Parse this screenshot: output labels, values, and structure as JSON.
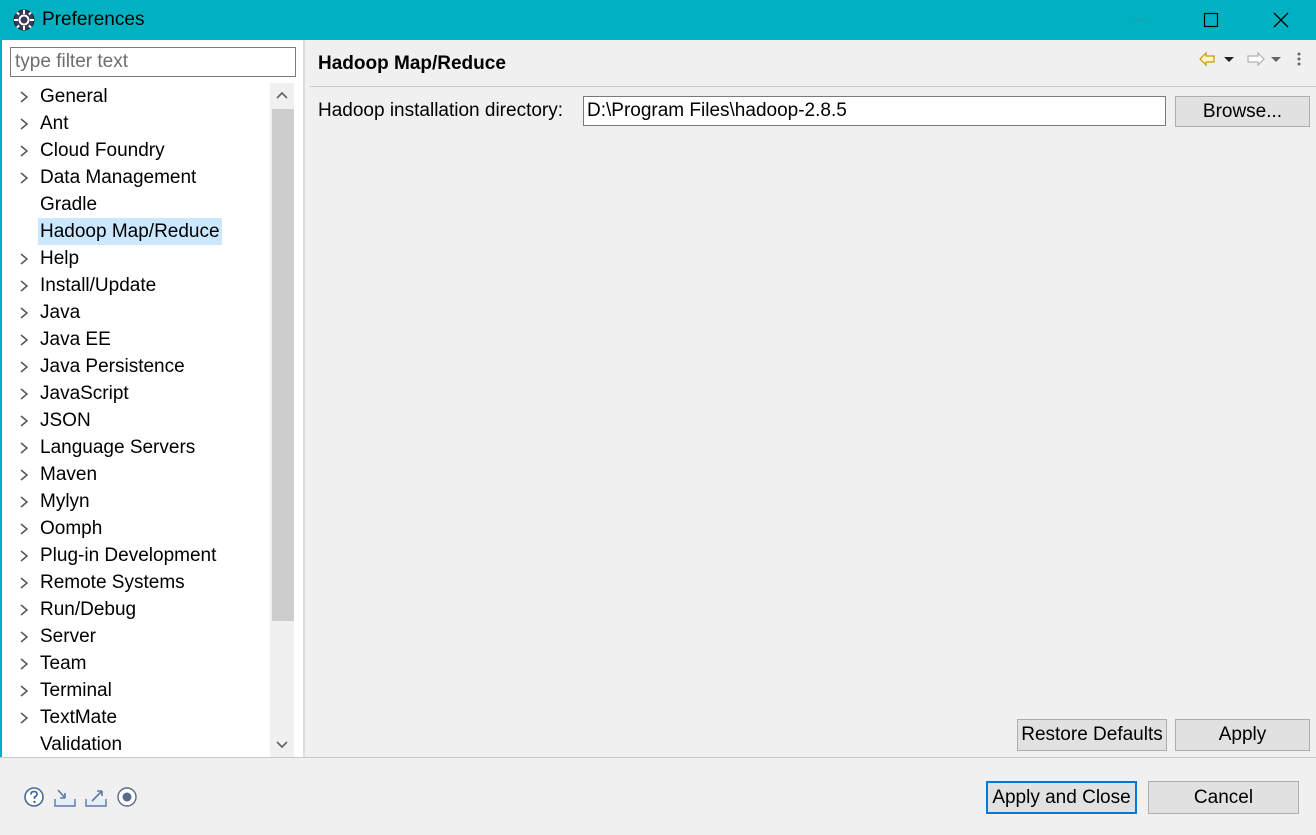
{
  "window": {
    "title": "Preferences"
  },
  "filter": {
    "placeholder": "type filter text",
    "value": ""
  },
  "tree": {
    "items": [
      {
        "label": "General",
        "expandable": true
      },
      {
        "label": "Ant",
        "expandable": true
      },
      {
        "label": "Cloud Foundry",
        "expandable": true
      },
      {
        "label": "Data Management",
        "expandable": true
      },
      {
        "label": "Gradle",
        "expandable": false
      },
      {
        "label": "Hadoop Map/Reduce",
        "expandable": false,
        "selected": true
      },
      {
        "label": "Help",
        "expandable": true
      },
      {
        "label": "Install/Update",
        "expandable": true
      },
      {
        "label": "Java",
        "expandable": true
      },
      {
        "label": "Java EE",
        "expandable": true
      },
      {
        "label": "Java Persistence",
        "expandable": true
      },
      {
        "label": "JavaScript",
        "expandable": true
      },
      {
        "label": "JSON",
        "expandable": true
      },
      {
        "label": "Language Servers",
        "expandable": true
      },
      {
        "label": "Maven",
        "expandable": true
      },
      {
        "label": "Mylyn",
        "expandable": true
      },
      {
        "label": "Oomph",
        "expandable": true
      },
      {
        "label": "Plug-in Development",
        "expandable": true
      },
      {
        "label": "Remote Systems",
        "expandable": true
      },
      {
        "label": "Run/Debug",
        "expandable": true
      },
      {
        "label": "Server",
        "expandable": true
      },
      {
        "label": "Team",
        "expandable": true
      },
      {
        "label": "Terminal",
        "expandable": true
      },
      {
        "label": "TextMate",
        "expandable": true
      },
      {
        "label": "Validation",
        "expandable": false
      }
    ]
  },
  "page": {
    "title": "Hadoop Map/Reduce",
    "dir_label": "Hadoop installation directory:",
    "dir_value": "D:\\Program Files\\hadoop-2.8.5",
    "browse_label": "Browse...",
    "restore_label": "Restore Defaults",
    "apply_label": "Apply"
  },
  "footer": {
    "apply_close_label": "Apply and Close",
    "cancel_label": "Cancel"
  },
  "colors": {
    "titlebar": "#00b2c1",
    "selection": "#cce8ff",
    "default_button_border": "#0078d7"
  }
}
